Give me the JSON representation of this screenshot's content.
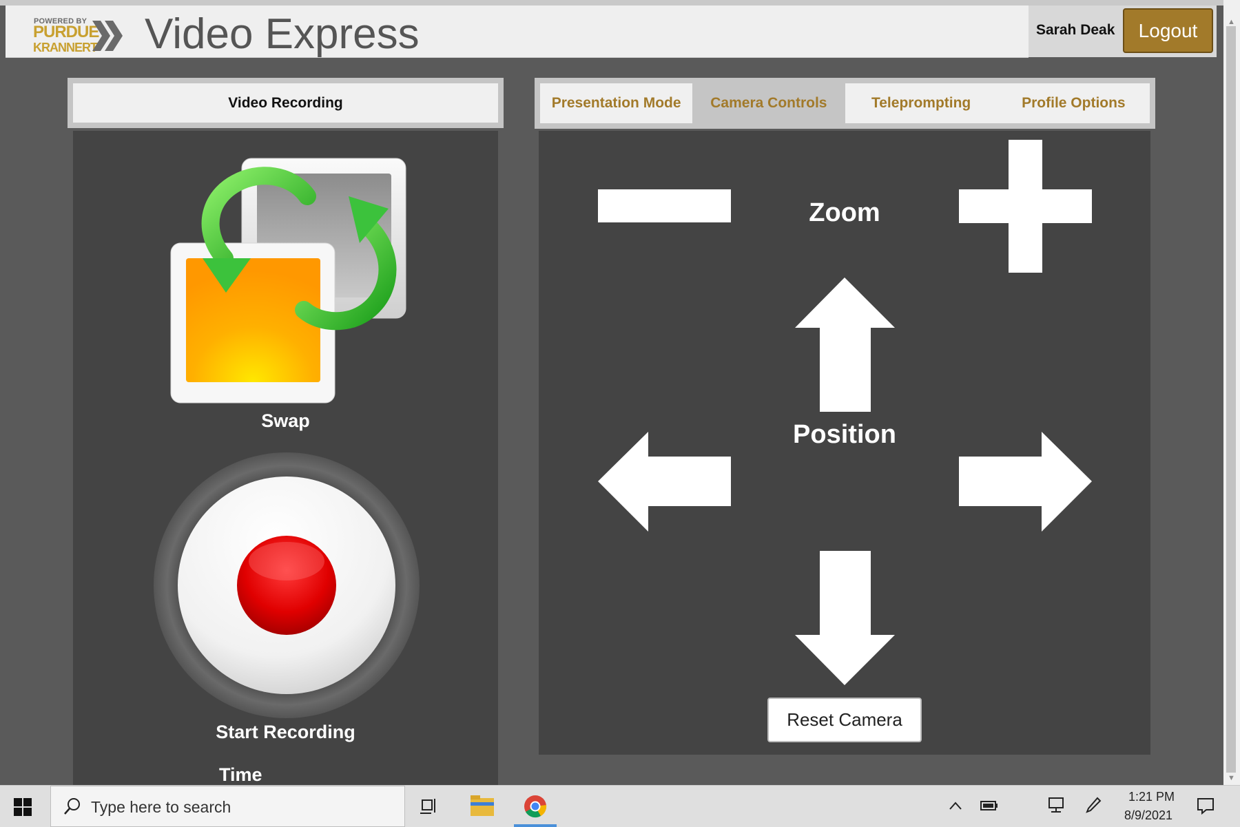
{
  "header": {
    "logo_powered": "POWERED BY",
    "logo_purdue": "PURDUE",
    "logo_krannert": "KRANNERT",
    "app_title": "Video Express",
    "user_name": "Sarah Deak",
    "logout_label": "Logout"
  },
  "left_panel": {
    "tab_label": "Video Recording",
    "swap_label": "Swap",
    "record_label": "Start Recording",
    "time_label": "Time"
  },
  "right_panel": {
    "tabs": [
      {
        "label": "Presentation Mode",
        "active": false
      },
      {
        "label": "Camera Controls",
        "active": true
      },
      {
        "label": "Teleprompting",
        "active": false
      },
      {
        "label": "Profile Options",
        "active": false
      }
    ],
    "zoom_label": "Zoom",
    "position_label": "Position",
    "reset_label": "Reset Camera",
    "icons": [
      "zoom-out-icon",
      "zoom-in-icon",
      "arrow-up-icon",
      "arrow-left-icon",
      "arrow-right-icon",
      "arrow-down-icon"
    ]
  },
  "taskbar": {
    "search_placeholder": "Type here to search",
    "time": "1:21 PM",
    "date": "8/9/2021",
    "icons": [
      "windows-start-icon",
      "search-icon",
      "task-view-icon",
      "file-explorer-icon",
      "chrome-icon",
      "chevron-up-icon",
      "battery-icon",
      "network-icon",
      "pen-icon",
      "notification-icon"
    ]
  },
  "colors": {
    "accent_gold": "#a27a2a",
    "panel_dark": "#444444",
    "page_bg": "#5a5a5a"
  }
}
